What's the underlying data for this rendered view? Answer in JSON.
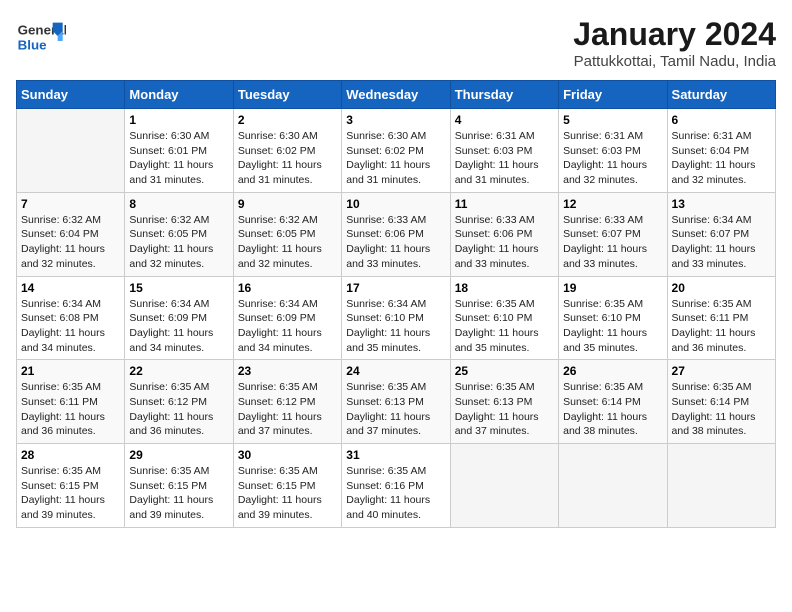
{
  "header": {
    "logo_line1": "General",
    "logo_line2": "Blue",
    "title": "January 2024",
    "subtitle": "Pattukkottai, Tamil Nadu, India"
  },
  "weekdays": [
    "Sunday",
    "Monday",
    "Tuesday",
    "Wednesday",
    "Thursday",
    "Friday",
    "Saturday"
  ],
  "weeks": [
    [
      {
        "day": "",
        "info": ""
      },
      {
        "day": "1",
        "info": "Sunrise: 6:30 AM\nSunset: 6:01 PM\nDaylight: 11 hours\nand 31 minutes."
      },
      {
        "day": "2",
        "info": "Sunrise: 6:30 AM\nSunset: 6:02 PM\nDaylight: 11 hours\nand 31 minutes."
      },
      {
        "day": "3",
        "info": "Sunrise: 6:30 AM\nSunset: 6:02 PM\nDaylight: 11 hours\nand 31 minutes."
      },
      {
        "day": "4",
        "info": "Sunrise: 6:31 AM\nSunset: 6:03 PM\nDaylight: 11 hours\nand 31 minutes."
      },
      {
        "day": "5",
        "info": "Sunrise: 6:31 AM\nSunset: 6:03 PM\nDaylight: 11 hours\nand 32 minutes."
      },
      {
        "day": "6",
        "info": "Sunrise: 6:31 AM\nSunset: 6:04 PM\nDaylight: 11 hours\nand 32 minutes."
      }
    ],
    [
      {
        "day": "7",
        "info": "Sunrise: 6:32 AM\nSunset: 6:04 PM\nDaylight: 11 hours\nand 32 minutes."
      },
      {
        "day": "8",
        "info": "Sunrise: 6:32 AM\nSunset: 6:05 PM\nDaylight: 11 hours\nand 32 minutes."
      },
      {
        "day": "9",
        "info": "Sunrise: 6:32 AM\nSunset: 6:05 PM\nDaylight: 11 hours\nand 32 minutes."
      },
      {
        "day": "10",
        "info": "Sunrise: 6:33 AM\nSunset: 6:06 PM\nDaylight: 11 hours\nand 33 minutes."
      },
      {
        "day": "11",
        "info": "Sunrise: 6:33 AM\nSunset: 6:06 PM\nDaylight: 11 hours\nand 33 minutes."
      },
      {
        "day": "12",
        "info": "Sunrise: 6:33 AM\nSunset: 6:07 PM\nDaylight: 11 hours\nand 33 minutes."
      },
      {
        "day": "13",
        "info": "Sunrise: 6:34 AM\nSunset: 6:07 PM\nDaylight: 11 hours\nand 33 minutes."
      }
    ],
    [
      {
        "day": "14",
        "info": "Sunrise: 6:34 AM\nSunset: 6:08 PM\nDaylight: 11 hours\nand 34 minutes."
      },
      {
        "day": "15",
        "info": "Sunrise: 6:34 AM\nSunset: 6:09 PM\nDaylight: 11 hours\nand 34 minutes."
      },
      {
        "day": "16",
        "info": "Sunrise: 6:34 AM\nSunset: 6:09 PM\nDaylight: 11 hours\nand 34 minutes."
      },
      {
        "day": "17",
        "info": "Sunrise: 6:34 AM\nSunset: 6:10 PM\nDaylight: 11 hours\nand 35 minutes."
      },
      {
        "day": "18",
        "info": "Sunrise: 6:35 AM\nSunset: 6:10 PM\nDaylight: 11 hours\nand 35 minutes."
      },
      {
        "day": "19",
        "info": "Sunrise: 6:35 AM\nSunset: 6:10 PM\nDaylight: 11 hours\nand 35 minutes."
      },
      {
        "day": "20",
        "info": "Sunrise: 6:35 AM\nSunset: 6:11 PM\nDaylight: 11 hours\nand 36 minutes."
      }
    ],
    [
      {
        "day": "21",
        "info": "Sunrise: 6:35 AM\nSunset: 6:11 PM\nDaylight: 11 hours\nand 36 minutes."
      },
      {
        "day": "22",
        "info": "Sunrise: 6:35 AM\nSunset: 6:12 PM\nDaylight: 11 hours\nand 36 minutes."
      },
      {
        "day": "23",
        "info": "Sunrise: 6:35 AM\nSunset: 6:12 PM\nDaylight: 11 hours\nand 37 minutes."
      },
      {
        "day": "24",
        "info": "Sunrise: 6:35 AM\nSunset: 6:13 PM\nDaylight: 11 hours\nand 37 minutes."
      },
      {
        "day": "25",
        "info": "Sunrise: 6:35 AM\nSunset: 6:13 PM\nDaylight: 11 hours\nand 37 minutes."
      },
      {
        "day": "26",
        "info": "Sunrise: 6:35 AM\nSunset: 6:14 PM\nDaylight: 11 hours\nand 38 minutes."
      },
      {
        "day": "27",
        "info": "Sunrise: 6:35 AM\nSunset: 6:14 PM\nDaylight: 11 hours\nand 38 minutes."
      }
    ],
    [
      {
        "day": "28",
        "info": "Sunrise: 6:35 AM\nSunset: 6:15 PM\nDaylight: 11 hours\nand 39 minutes."
      },
      {
        "day": "29",
        "info": "Sunrise: 6:35 AM\nSunset: 6:15 PM\nDaylight: 11 hours\nand 39 minutes."
      },
      {
        "day": "30",
        "info": "Sunrise: 6:35 AM\nSunset: 6:15 PM\nDaylight: 11 hours\nand 39 minutes."
      },
      {
        "day": "31",
        "info": "Sunrise: 6:35 AM\nSunset: 6:16 PM\nDaylight: 11 hours\nand 40 minutes."
      },
      {
        "day": "",
        "info": ""
      },
      {
        "day": "",
        "info": ""
      },
      {
        "day": "",
        "info": ""
      }
    ]
  ]
}
